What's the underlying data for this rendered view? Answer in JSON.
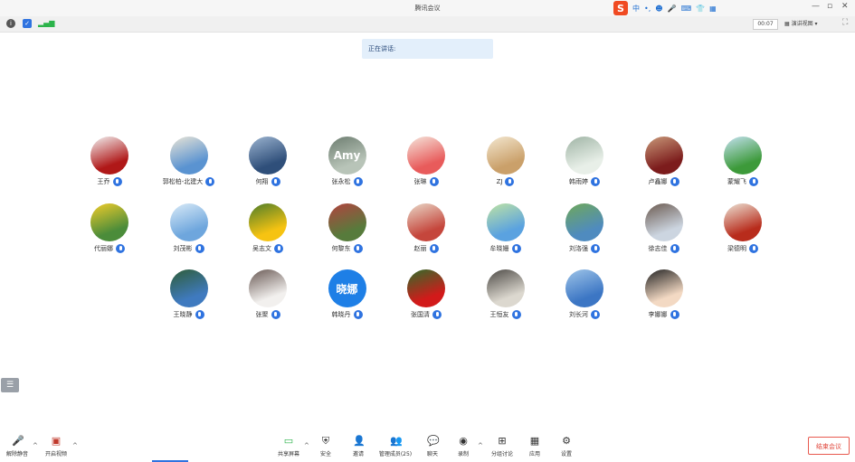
{
  "window": {
    "title": "腾讯会议"
  },
  "ime": {
    "logo": "S",
    "items": [
      "中",
      "•,",
      "☻",
      "🎤",
      "⌨",
      "👕",
      "▦"
    ]
  },
  "toolbar": {
    "timer": "00:07",
    "view": "演讲视图"
  },
  "speaking": {
    "label": "正在讲话:"
  },
  "participants": [
    {
      "name": "王乔",
      "colors": [
        "#b01818",
        "#f2f2f2"
      ]
    },
    {
      "name": "郭松柏-北建大",
      "colors": [
        "#5a93d1",
        "#e9e4d6"
      ]
    },
    {
      "name": "何翔",
      "colors": [
        "#2f4f7a",
        "#9cb4d0"
      ]
    },
    {
      "name": "张永松",
      "colors": [
        "#b8c4b8",
        "#6d7d70"
      ],
      "glyph": "Amy"
    },
    {
      "name": "张琳",
      "colors": [
        "#e85b5b",
        "#f5e6dc"
      ]
    },
    {
      "name": "ZJ",
      "colors": [
        "#caa06a",
        "#f3e7d0"
      ]
    },
    {
      "name": "韩雨婷",
      "colors": [
        "#e8efe8",
        "#9fb4a5"
      ]
    },
    {
      "name": "卢鑫娜",
      "colors": [
        "#7c1c1c",
        "#c99a7a"
      ]
    },
    {
      "name": "蒙耀飞",
      "colors": [
        "#3d9a3a",
        "#c4e1f0"
      ]
    },
    {
      "name": "代丽娜",
      "colors": [
        "#4b8c3a",
        "#f1cc2a"
      ]
    },
    {
      "name": "刘茂彬",
      "colors": [
        "#6ea6dd",
        "#d9eaf7"
      ]
    },
    {
      "name": "吴志文",
      "colors": [
        "#f6c312",
        "#4d7d2a"
      ]
    },
    {
      "name": "何黎东",
      "colors": [
        "#577b3c",
        "#b2433f"
      ]
    },
    {
      "name": "赵丽",
      "colors": [
        "#c5463c",
        "#e9d8c8"
      ]
    },
    {
      "name": "牟晓姗",
      "colors": [
        "#5aa2e0",
        "#bfe3a4"
      ]
    },
    {
      "name": "刘洛强",
      "colors": [
        "#4f8bbf",
        "#6fa85a"
      ]
    },
    {
      "name": "徐志佳",
      "colors": [
        "#ccd5e0",
        "#6b5a50"
      ]
    },
    {
      "name": "梁德明",
      "colors": [
        "#b82c1c",
        "#ece3d5"
      ]
    },
    {
      "name": "王晓静",
      "colors": [
        "#3f7abf",
        "#2f5d38"
      ]
    },
    {
      "name": "张聚",
      "colors": [
        "#f2f0ee",
        "#6a5a55"
      ]
    },
    {
      "name": "韩晓丹",
      "colors": [
        "#1e7fe6",
        "#1e7fe6"
      ],
      "glyph": "晓娜"
    },
    {
      "name": "张国清",
      "colors": [
        "#d21a1a",
        "#2f6d2a"
      ]
    },
    {
      "name": "王恒友",
      "colors": [
        "#dcd8cf",
        "#4d4a46"
      ]
    },
    {
      "name": "刘长河",
      "colors": [
        "#3c76c4",
        "#9ec4e8"
      ]
    },
    {
      "name": "李娜娜",
      "colors": [
        "#f3d9c3",
        "#222222"
      ]
    }
  ],
  "bottom": {
    "mute": "解除静音",
    "video": "开启视频",
    "share": "共享屏幕",
    "security": "安全",
    "invite": "邀请",
    "members": "管理成员(25)",
    "chat": "聊天",
    "record": "录制",
    "breakout": "分组讨论",
    "apps": "应用",
    "settings": "设置",
    "end": "结束会议"
  },
  "colors": {
    "accent": "#2f73e0",
    "end": "#e0453a"
  }
}
